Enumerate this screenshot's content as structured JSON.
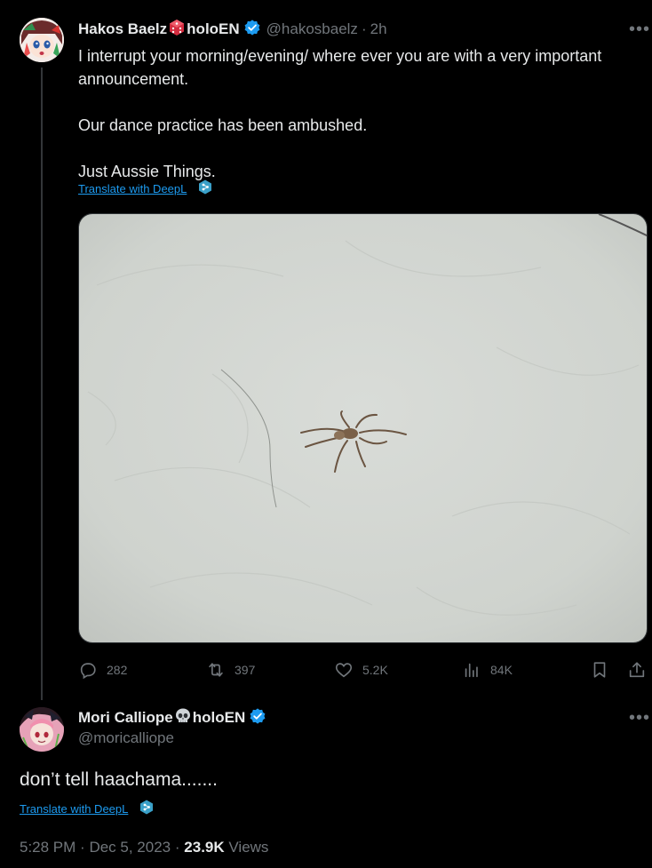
{
  "tweet": {
    "author_name": "Hakos Baelz",
    "author_suffix": "holoEN",
    "handle": "@hakosbaelz",
    "separator": "·",
    "time_ago": "2h",
    "more_label": "•••",
    "text_lines": [
      "I interrupt your morning/evening/ where ever you are with a very important announcement.",
      "Our dance practice has been ambushed.",
      "Just Aussie Things."
    ],
    "translate_label": "Translate with DeepL",
    "image_icon": "spider-photo",
    "stats": {
      "replies": "282",
      "reposts": "397",
      "likes": "5.2K",
      "views": "84K"
    }
  },
  "reply": {
    "author_name": "Mori Calliope",
    "author_suffix": "holoEN",
    "handle": "@moricalliope",
    "more_label": "•••",
    "text": "don’t tell haachama.......",
    "translate_label": "Translate with DeepL",
    "time": "5:28 PM",
    "separator1": "·",
    "date": "Dec 5, 2023",
    "separator2": "·",
    "view_count": "23.9K",
    "views_label": "Views"
  },
  "colors": {
    "background": "#000000",
    "text": "#e7e9ea",
    "muted": "#71767b",
    "link": "#1d9bf0",
    "verified": "#1d9bf0"
  }
}
